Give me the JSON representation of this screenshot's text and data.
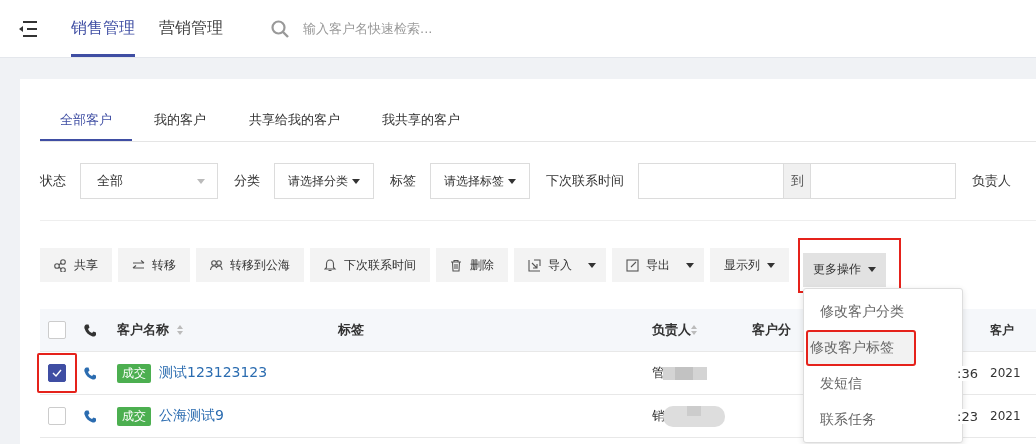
{
  "top_nav": {
    "tabs": [
      {
        "label": "销售管理",
        "selected": true
      },
      {
        "label": "营销管理",
        "selected": false
      }
    ],
    "search": {
      "placeholder": "输入客户名快速检索..."
    }
  },
  "customer_tabs": [
    {
      "label": "全部客户",
      "selected": true
    },
    {
      "label": "我的客户",
      "selected": false
    },
    {
      "label": "共享给我的客户",
      "selected": false
    },
    {
      "label": "我共享的客户",
      "selected": false
    }
  ],
  "filters": [
    {
      "kind": "select",
      "label": "状态",
      "value": "全部"
    },
    {
      "kind": "dropdown",
      "label": "分类",
      "value": "请选择分类"
    },
    {
      "kind": "dropdown",
      "label": "标签",
      "value": "请选择标签"
    },
    {
      "kind": "range",
      "label": "下次联系时间",
      "separator": "到"
    },
    {
      "kind": "label",
      "label": "负责人"
    }
  ],
  "toolbar": [
    {
      "kind": "plain",
      "label": "共享",
      "highlighted": false
    },
    {
      "kind": "plain",
      "label": "转移",
      "highlighted": false
    },
    {
      "kind": "plain",
      "label": "转移到公海",
      "highlighted": false
    },
    {
      "kind": "plain",
      "label": "下次联系时间",
      "highlighted": false
    },
    {
      "kind": "plain",
      "label": "删除",
      "highlighted": false
    },
    {
      "kind": "split",
      "label": "导入",
      "highlighted": false
    },
    {
      "kind": "split",
      "label": "导出",
      "highlighted": false
    },
    {
      "kind": "dropdown",
      "label": "显示列",
      "highlighted": false
    },
    {
      "kind": "dropdown",
      "label": "更多操作",
      "highlighted": true,
      "expanded": true
    }
  ],
  "table": {
    "header_checked": false,
    "columns": [
      {
        "label": "客户名称",
        "sortable": true
      },
      {
        "label": "标签",
        "sortable": false
      },
      {
        "label": "负责人",
        "sortable": true
      },
      {
        "label": "客户分",
        "sortable": false
      },
      {
        "label": "客户",
        "sortable": false
      }
    ],
    "rows": [
      {
        "selected": true,
        "highlighted": true,
        "tag": "成交",
        "name": "测试123123123",
        "owner": "管",
        "time": ":36",
        "year": "2021"
      },
      {
        "selected": false,
        "highlighted": false,
        "tag": "成交",
        "name": "公海测试9",
        "owner": "销",
        "time": ":23",
        "year": "2021"
      }
    ]
  },
  "more_menu": {
    "items": [
      {
        "label": "修改客户分类",
        "hovered": false,
        "highlighted": false
      },
      {
        "label": "修改客户标签",
        "hovered": true,
        "highlighted": true
      },
      {
        "label": "发短信",
        "hovered": false,
        "highlighted": false
      },
      {
        "label": "联系任务",
        "hovered": false,
        "highlighted": false
      }
    ]
  }
}
